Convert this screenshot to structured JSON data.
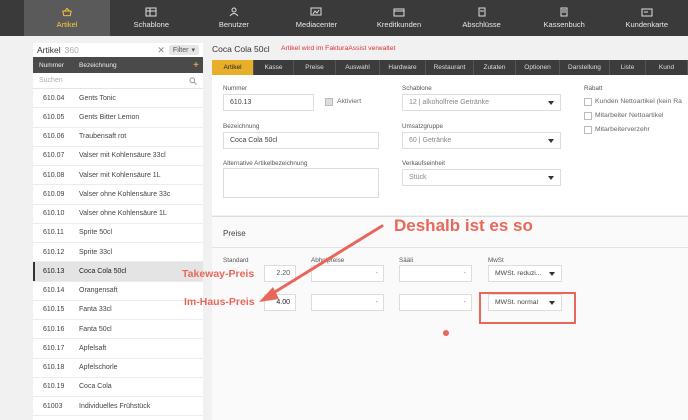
{
  "nav": [
    {
      "label": "Artikel",
      "icon": "artikel-icon",
      "active": true
    },
    {
      "label": "Schablone",
      "icon": "schablone-icon",
      "active": false
    },
    {
      "label": "Benutzer",
      "icon": "benutzer-icon",
      "active": false
    },
    {
      "label": "Mediacenter",
      "icon": "mediacenter-icon",
      "active": false
    },
    {
      "label": "Kreditkunden",
      "icon": "kreditkunden-icon",
      "active": false
    },
    {
      "label": "Abschlüsse",
      "icon": "abschluesse-icon",
      "active": false
    },
    {
      "label": "Kassenbuch",
      "icon": "kassenbuch-icon",
      "active": false
    },
    {
      "label": "Kundenkarte",
      "icon": "kundenkarte-icon",
      "active": false
    }
  ],
  "list": {
    "title": "Artikel",
    "count": "360",
    "filter_label": "Filter",
    "col_number": "Nummer",
    "col_desc": "Bezeichnung",
    "search_placeholder": "Suchen",
    "rows": [
      {
        "num": "610.04",
        "desc": "Gents Tonic",
        "selected": false
      },
      {
        "num": "610.05",
        "desc": "Gents Bitter Lemon",
        "selected": false
      },
      {
        "num": "610.06",
        "desc": "Traubensaft rot",
        "selected": false
      },
      {
        "num": "610.07",
        "desc": "Valser mit Kohlensäure 33cl",
        "selected": false
      },
      {
        "num": "610.08",
        "desc": "Valser mit Kohlensäure 1L",
        "selected": false
      },
      {
        "num": "610.09",
        "desc": "Valser ohne Kohlensäure 33c",
        "selected": false
      },
      {
        "num": "610.10",
        "desc": "Valser ohne Kohlensäure 1L",
        "selected": false
      },
      {
        "num": "610.11",
        "desc": "Sprite 50cl",
        "selected": false
      },
      {
        "num": "610.12",
        "desc": "Sprite 33cl",
        "selected": false
      },
      {
        "num": "610.13",
        "desc": "Coca Cola 50cl",
        "selected": true
      },
      {
        "num": "610.14",
        "desc": "Orangensaft",
        "selected": false
      },
      {
        "num": "610.15",
        "desc": "Fanta 33cl",
        "selected": false
      },
      {
        "num": "610.16",
        "desc": "Fanta 50cl",
        "selected": false
      },
      {
        "num": "610.17",
        "desc": "Apfelsaft",
        "selected": false
      },
      {
        "num": "610.18",
        "desc": "Apfelschorle",
        "selected": false
      },
      {
        "num": "610.19",
        "desc": "Coca Cola",
        "selected": false
      },
      {
        "num": "61003",
        "desc": "Individuelles Frühstück",
        "selected": false
      }
    ]
  },
  "detail": {
    "title": "Coca Cola 50cl",
    "fa_note": "Artikel wird im FakturaAssist verwaltet",
    "tabs": [
      "Artikel",
      "Kasse",
      "Preise",
      "Auswahl",
      "Hardware",
      "Restaurant",
      "Zutaten",
      "Optionen",
      "Darstellung",
      "Liste",
      "Kund"
    ],
    "nummer_label": "Nummer",
    "nummer_value": "610.13",
    "aktiviert_label": "Aktiviert",
    "bezeichnung_label": "Bezeichnung",
    "bezeichnung_value": "Coca Cola 50cl",
    "alt_label": "Alternative Artikelbezeichnung",
    "alt_value": "",
    "schablone_label": "Schablone",
    "schablone_value": "12 | alkoholfreie Getränke",
    "umsatz_label": "Umsatzgruppe",
    "umsatz_value": "60 | Getränke",
    "vk_label": "Verkaufseinheit",
    "vk_value": "Stück",
    "rabatt_label": "Rabatt",
    "rabatt_options": [
      "Kunden Nettoartikel (kein Ra",
      "Mitarbeiter Nettoartikel",
      "Mitarbeiterverzehr"
    ]
  },
  "preise": {
    "title": "Preise",
    "col_standard": "Standard",
    "col_abhol": "Abholpreise",
    "col_saali": "Sääli",
    "col_mwst": "MwSt",
    "row1": {
      "standard": "2.20",
      "abhol": "-",
      "saali": "-",
      "mwst": "MWSt. reduzi..."
    },
    "row2": {
      "standard": "4.00",
      "abhol": "-",
      "saali": "-",
      "mwst": "MWSt. normal"
    }
  },
  "annotations": {
    "headline": "Deshalb ist es so",
    "takeway": "Takeway-Preis",
    "imhaus": "Im-Haus-Preis"
  },
  "colors": {
    "accent": "#e8b02a",
    "annotation": "#e8675b",
    "nav_bg": "#3a3a3a"
  }
}
